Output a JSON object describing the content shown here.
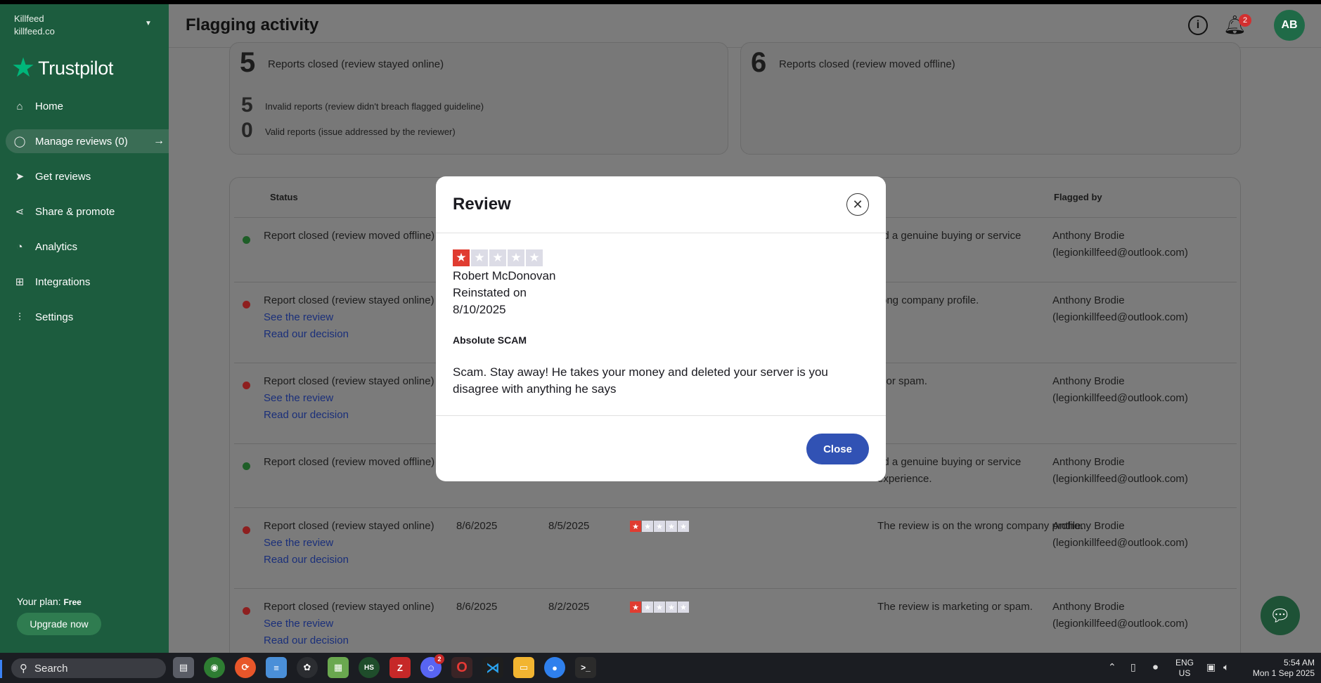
{
  "sidebar": {
    "business_name": "Killfeed",
    "business_domain": "killfeed.co",
    "logo_text": "Trustpilot",
    "items": [
      {
        "label": "Home",
        "icon": "home-icon"
      },
      {
        "label": "Manage reviews (0)",
        "icon": "chat-bubble-icon",
        "active": true
      },
      {
        "label": "Get reviews",
        "icon": "paper-plane-icon"
      },
      {
        "label": "Share & promote",
        "icon": "share-icon"
      },
      {
        "label": "Analytics",
        "icon": "pie-chart-icon"
      },
      {
        "label": "Integrations",
        "icon": "integrations-icon"
      },
      {
        "label": "Settings",
        "icon": "sliders-icon"
      }
    ],
    "plan_label": "Your plan:",
    "plan_value": "Free",
    "upgrade_label": "Upgrade now"
  },
  "header": {
    "title": "Flagging activity",
    "notification_count": "2",
    "avatar_initials": "AB"
  },
  "summary": {
    "left": {
      "main_count": "5",
      "main_label": "Reports closed (review stayed online)",
      "sub": [
        {
          "count": "5",
          "label": "Invalid reports (review didn't breach flagged guideline)"
        },
        {
          "count": "0",
          "label": "Valid reports (issue addressed by the reviewer)"
        }
      ]
    },
    "right": {
      "main_count": "6",
      "main_label": "Reports closed (review moved offline)"
    }
  },
  "table": {
    "headers": {
      "status": "Status",
      "flagged_by": "Flagged by"
    },
    "see_review": "See the review",
    "read_decision": "Read our decision",
    "rows": [
      {
        "status": "Report closed (review moved offline)",
        "status_color": "green",
        "reason": "ad a genuine buying or service",
        "reason2": "",
        "flagger": "Anthony Brodie",
        "email": "(legionkillfeed@outlook.com)",
        "links": false
      },
      {
        "status": "Report closed (review stayed online)",
        "status_color": "red",
        "reason": "rong company profile.",
        "reason2": "",
        "flagger": "Anthony Brodie",
        "email": "(legionkillfeed@outlook.com)",
        "links": true
      },
      {
        "status": "Report closed (review stayed online)",
        "status_color": "red",
        "reason": "g or spam.",
        "reason2": "",
        "flagger": "Anthony Brodie",
        "email": "(legionkillfeed@outlook.com)",
        "links": true
      },
      {
        "status": "Report closed (review moved offline)",
        "status_color": "green",
        "reason": "ad a genuine buying or service",
        "reason2": "experience.",
        "flagger": "Anthony Brodie",
        "email": "(legionkillfeed@outlook.com)",
        "links": false
      },
      {
        "status": "Report closed (review stayed online)",
        "status_color": "red",
        "date1": "8/6/2025",
        "date2": "8/5/2025",
        "reason": "The review is on the wrong company profile.",
        "reason2": "",
        "flagger": "Anthony Brodie",
        "email": "(legionkillfeed@outlook.com)",
        "links": true,
        "rating": 1
      },
      {
        "status": "Report closed (review stayed online)",
        "status_color": "red",
        "date1": "8/6/2025",
        "date2": "8/2/2025",
        "reason": "The review is marketing or spam.",
        "reason2": "",
        "flagger": "Anthony Brodie",
        "email": "(legionkillfeed@outlook.com)",
        "links": true,
        "rating": 1
      }
    ]
  },
  "modal": {
    "title": "Review",
    "rating": 1,
    "reviewer": "Robert McDonovan",
    "reinstated_label": "Reinstated on",
    "reinstated_date": "8/10/2025",
    "review_title": "Absolute SCAM",
    "review_body": "Scam. Stay away! He takes your money and deleted your server is you disagree with anything he says",
    "close_label": "Close"
  },
  "taskbar": {
    "search_placeholder": "Search",
    "discord_badge": "2",
    "lang_line1": "ENG",
    "lang_line2": "US",
    "time": "5:54 AM",
    "date": "Mon 1 Sep 2025"
  },
  "colors": {
    "sidebar_bg": "#1c5c3e",
    "star_red": "#e03c31",
    "star_grey": "#dcdce6",
    "primary_button": "#3152b4"
  }
}
